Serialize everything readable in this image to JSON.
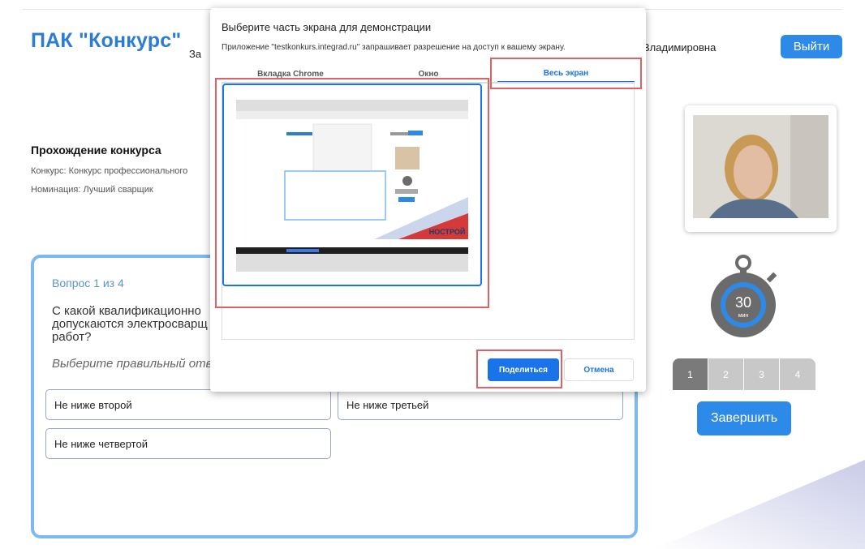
{
  "header": {
    "logo": "ПАК \"Конкурс\"",
    "partial_word": "За",
    "username": "Владимировна",
    "logout_label": "Выйти"
  },
  "contest": {
    "section_title": "Прохождение конкурса",
    "contest_line": "Конкурс: Конкурс профессионального",
    "nomination_line": "Номинация: Лучший сварщик"
  },
  "question": {
    "counter": "Вопрос 1 из 4",
    "text": "С какой квалификационно допускаются электросварщ работ?",
    "hint": "Выберите правильный отве",
    "answers": [
      "Не ниже второй",
      "Не ниже третьей",
      "Не ниже четвертой"
    ]
  },
  "timer": {
    "minutes": "30",
    "unit": "мин"
  },
  "pager": {
    "pages": [
      "1",
      "2",
      "3",
      "4"
    ],
    "active": 1
  },
  "finish_label": "Завершить",
  "dialog": {
    "title": "Выберите часть экрана для демонстрации",
    "subtitle": "Приложение \"testkonkurs.integrad.ru\" запрашивает разрешение на доступ к вашему экрану.",
    "tabs": [
      "Вкладка Chrome",
      "Окно",
      "Весь экран"
    ],
    "selected_tab": "Весь экран",
    "thumb_brand": "НОСТРОЙ",
    "share_label": "Поделиться",
    "cancel_label": "Отмена"
  },
  "colors": {
    "brand_blue": "#2b7cd3",
    "button_blue": "#2d8ae8",
    "chrome_blue": "#1a73e8",
    "card_border": "#7db9ef",
    "highlight_red": "#e06161"
  }
}
